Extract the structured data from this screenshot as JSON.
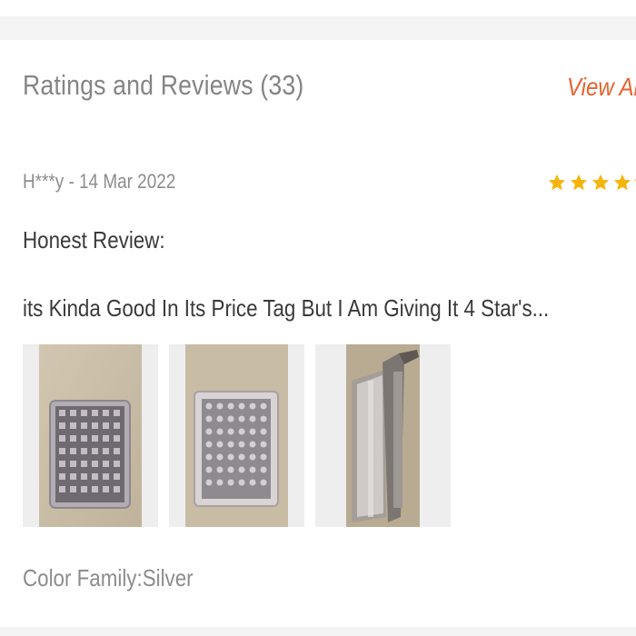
{
  "section": {
    "title": "Ratings and Reviews (33)",
    "view_all_label": "View All"
  },
  "review": {
    "author": "H***y",
    "date": "14 Mar 2022",
    "meta_text": "H***y - 14 Mar 2022",
    "rating": 4,
    "rating_max": 5,
    "title": "Honest Review:",
    "body": "its Kinda Good In Its Price Tag But I Am Giving It 4 Star's...",
    "photos": [
      {
        "icon": "product-photo-grid-blade-top"
      },
      {
        "icon": "product-photo-grid-blade-angle"
      },
      {
        "icon": "product-photo-side-handle"
      }
    ],
    "sku": "Color Family:Silver"
  },
  "colors": {
    "accent": "#e8612c",
    "star_filled": "#f5b50a",
    "star_empty": "#f5b50a",
    "muted_text": "#858585",
    "body_text": "#3a3a3a"
  }
}
